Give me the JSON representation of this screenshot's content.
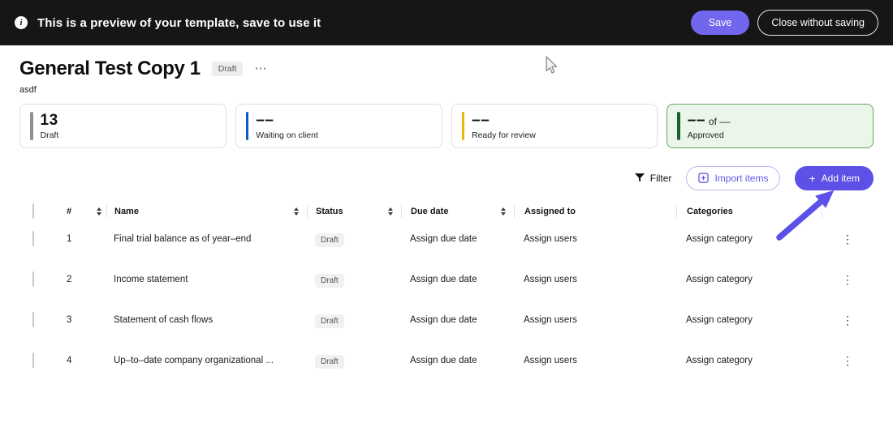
{
  "banner": {
    "message": "This is a preview of your template, save to use it",
    "save_label": "Save",
    "close_label": "Close without saving"
  },
  "header": {
    "title": "General Test Copy 1",
    "status_badge": "Draft",
    "menu_glyph": "⋯",
    "subtitle": "asdf"
  },
  "stat_cards": [
    {
      "value": "13",
      "label": "Draft",
      "accent_color": "#8f8f8f",
      "highlighted": false
    },
    {
      "value": "––",
      "label": "Waiting on client",
      "accent_color": "#0B5CC9",
      "highlighted": false
    },
    {
      "value": "––",
      "label": "Ready for review",
      "accent_color": "#EFB302",
      "highlighted": false
    },
    {
      "value": "––",
      "value_suffix": "of ––",
      "label": "Approved",
      "accent_color": "#1F5F2F",
      "highlighted": true
    }
  ],
  "toolbar": {
    "filter_label": "Filter",
    "import_label": "Import items",
    "add_icon": "+",
    "add_label": "Add item"
  },
  "table": {
    "columns": [
      "#",
      "Name",
      "Status",
      "Due date",
      "Assigned to",
      "Categories"
    ],
    "kebab_glyph": "⋮",
    "rows": [
      {
        "num": "1",
        "name": "Final trial balance as of year–end",
        "status": "Draft",
        "due": "Assign due date",
        "assigned": "Assign users",
        "category": "Assign category"
      },
      {
        "num": "2",
        "name": "Income statement",
        "status": "Draft",
        "due": "Assign due date",
        "assigned": "Assign users",
        "category": "Assign category"
      },
      {
        "num": "3",
        "name": "Statement of cash flows",
        "status": "Draft",
        "due": "Assign due date",
        "assigned": "Assign users",
        "category": "Assign category"
      },
      {
        "num": "4",
        "name": "Up–to–date company organizational ...",
        "status": "Draft",
        "due": "Assign due date",
        "assigned": "Assign users",
        "category": "Assign category"
      }
    ]
  },
  "colors": {
    "banner_bg": "#161616",
    "brand_purple": "#5C50E6",
    "save_purple": "#7366EE",
    "arrow_purple": "#5B51E8",
    "approved_bg": "#E9F6E9",
    "approved_border": "#69A565"
  }
}
